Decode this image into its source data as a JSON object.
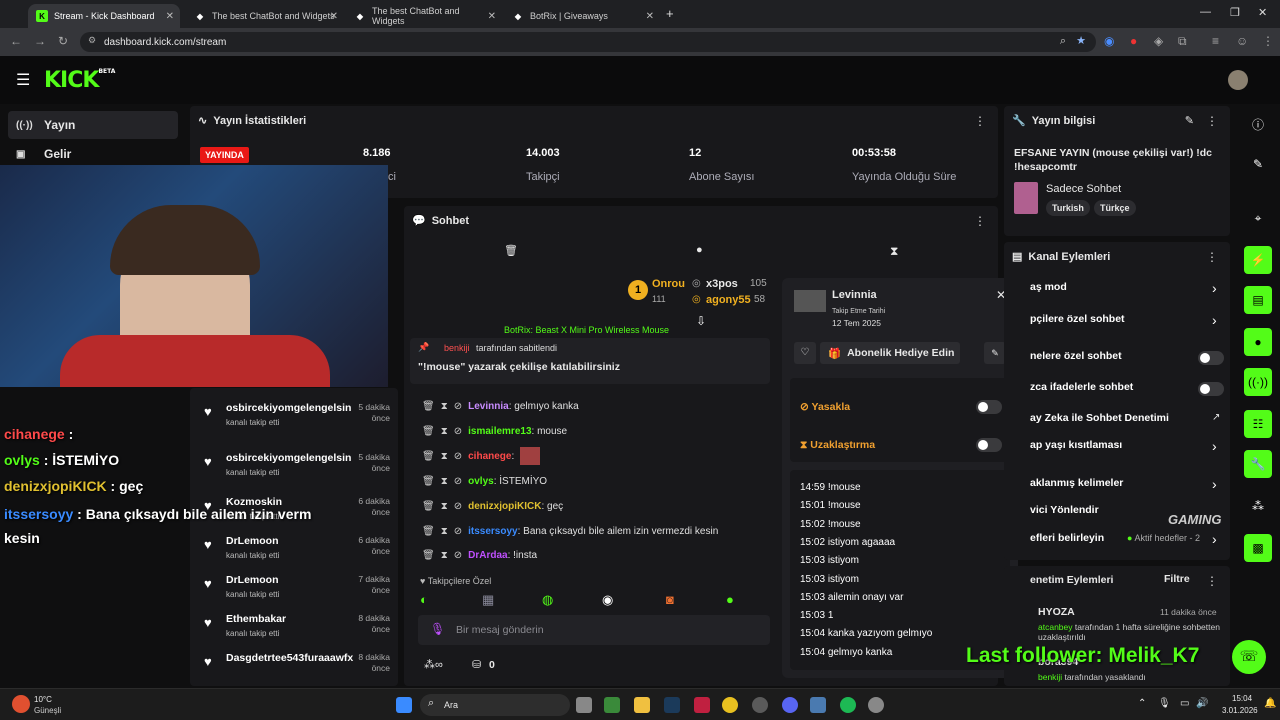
{
  "browser": {
    "tabs": [
      {
        "title": "Stream - Kick Dashboard",
        "active": true
      },
      {
        "title": "The best ChatBot and Widgets",
        "active": false
      },
      {
        "title": "The best ChatBot and Widgets",
        "active": false
      },
      {
        "title": "BotRix | Giveaways",
        "active": false
      }
    ],
    "url": "dashboard.kick.com/stream"
  },
  "header": {
    "logo": "KICK",
    "logo_sup": "BETA"
  },
  "sidebar": {
    "items": [
      {
        "label": "Yayın",
        "icon": "broadcast-icon"
      },
      {
        "label": "Gelir",
        "icon": "revenue-icon"
      }
    ]
  },
  "stats": {
    "title": "Yayın İstatistikleri",
    "live_badge": "YAYINDA",
    "viewers_value": "8.186",
    "viewers_label_fragment": "ci",
    "followers_value": "14.003",
    "followers_label": "Takipçi",
    "subs_value": "12",
    "subs_label": "Abone Sayısı",
    "duration_value": "00:53:58",
    "duration_label": "Yayında Olduğu Süre"
  },
  "stream_info": {
    "title": "Yayın bilgisi",
    "stream_title": "EFSANE YAYIN (mouse çekilişi var!) !dc !hesapcomtr",
    "category": "Sadece Sohbet",
    "tags": [
      "Turkish",
      "Türkçe"
    ]
  },
  "chat": {
    "title": "Sohbet",
    "leaderboard": [
      {
        "rank": "1",
        "name": "Onrou",
        "value": "111"
      },
      {
        "name": "x3pos",
        "value": "105"
      },
      {
        "name": "agony55",
        "value": "58"
      }
    ],
    "truncated_top": "BotRix: Beast X Mini Pro Wireless Mouse",
    "pinned_by": "benkiji",
    "pinned_by_suffix": "tarafından sabitlendi",
    "pinned_message": "\"!mouse\" yazarak çekilişe katılabilirsiniz",
    "messages": [
      {
        "user": "Levinnia",
        "color": "#c88cff",
        "text": "gelmıyo kanka"
      },
      {
        "user": "ismailemre13",
        "color": "#53fc18",
        "text": "mouse"
      },
      {
        "user": "cihanege",
        "color": "#ff4a4a",
        "text": ""
      },
      {
        "user": "ovlys",
        "color": "#53fc18",
        "text": "İSTEMİYO"
      },
      {
        "user": "denizxjopiKICK",
        "color": "#e0c030",
        "text": "geç"
      },
      {
        "user": "itssersoyy",
        "color": "#3a8bff",
        "text": "Bana çıksaydı bile ailem izin vermezdi kesin"
      },
      {
        "user": "DrArdaa",
        "color": "#c050ff",
        "text": "!insta"
      }
    ],
    "follower_only_label": "Takipçilere Özel",
    "input_placeholder": "Bir mesaj gönderin",
    "points": "0"
  },
  "followers": [
    {
      "name": "osbircekiyomgelengelsin",
      "sub": "kanalı takip etti",
      "time": "5 dakika önce"
    },
    {
      "name": "osbircekiyomgelengelsin",
      "sub": "kanalı takip etti",
      "time": "5 dakika önce"
    },
    {
      "name": "Kozmoskin",
      "sub": "kanalı takip etti",
      "time": "6 dakika önce"
    },
    {
      "name": "DrLemoon",
      "sub": "kanalı takip etti",
      "time": "6 dakika önce"
    },
    {
      "name": "DrLemoon",
      "sub": "kanalı takip etti",
      "time": "7 dakika önce"
    },
    {
      "name": "Ethembakar",
      "sub": "kanalı takip etti",
      "time": "8 dakika önce"
    },
    {
      "name": "Dasgdetrtee543furaaawfx",
      "sub": "",
      "time": "8 dakika önce"
    }
  ],
  "overlay_chat": [
    {
      "user": "cihanege",
      "sep": " : ",
      "text": "",
      "color": "#ff4a4a"
    },
    {
      "user": "ovlys",
      "sep": " : ",
      "text": "İSTEMİYO",
      "color": "#53fc18"
    },
    {
      "user": "denizxjopiKICK",
      "sep": " : ",
      "text": "geç",
      "color": "#e0c030"
    },
    {
      "user": "itssersoyy",
      "sep": " : ",
      "text": "Bana çıksaydı bile ailem izin verm",
      "color": "#3a8bff"
    },
    {
      "user": "",
      "sep": "",
      "text": "kesin",
      "color": "#ffffff"
    }
  ],
  "user_card": {
    "name": "Levinnia",
    "follow_label": "Takip Etme Tarihi",
    "follow_date": "12 Tem 2025",
    "gift_label": "Abonelik Hediye Edin",
    "ban_label": "Yasakla",
    "timeout_label": "Uzaklaştırma",
    "history": [
      {
        "time": "14:59",
        "text": "!mouse"
      },
      {
        "time": "15:01",
        "text": "!mouse"
      },
      {
        "time": "15:02",
        "text": "!mouse"
      },
      {
        "time": "15:02",
        "text": "istiyom agaaaa"
      },
      {
        "time": "15:03",
        "text": "istiyom"
      },
      {
        "time": "15:03",
        "text": "istiyom"
      },
      {
        "time": "15:03",
        "text": "ailemin onayı var"
      },
      {
        "time": "15:03",
        "text": "1"
      },
      {
        "time": "15:04",
        "text": "kanka yazıyom gelmıyo"
      },
      {
        "time": "15:04",
        "text": "gelmıyo kanka"
      }
    ]
  },
  "channel_actions": {
    "title": "Kanal Eylemleri",
    "rows": [
      {
        "label": "aş mod",
        "control": "chevron"
      },
      {
        "label": "pçilere özel sohbet",
        "control": "chevron"
      },
      {
        "label": "nelere özel sohbet",
        "control": "toggle"
      },
      {
        "label": "zca ifadelerle sohbet",
        "control": "toggle"
      },
      {
        "label": "ay Zeka ile Sohbet Denetimi",
        "control": "external"
      },
      {
        "label": "ap yaşı kısıtlaması",
        "control": "chevron"
      },
      {
        "label": "aklanmış kelimeler",
        "control": "chevron"
      },
      {
        "label": "vici Yönlendir",
        "control": "none"
      },
      {
        "label": "efleri belirleyin",
        "control": "chevron"
      }
    ],
    "active_goals": "Aktif hedefler - 2"
  },
  "mod_actions": {
    "title": "enetim Eylemleri",
    "filter": "Filtre",
    "entries": [
      {
        "user": "HYOZA",
        "time": "11 dakika önce",
        "actor": "atcanbey",
        "text": "tarafından 1 hafta süreliğine sohbetten uzaklaştırıldı"
      },
      {
        "user": "bora394",
        "time": "",
        "actor": "benkiji",
        "text": "tarafından yasaklandı"
      }
    ]
  },
  "overlay": {
    "last_follower": "Last follower: Melik_K7",
    "gaming_logo": "GAMING"
  },
  "taskbar": {
    "temp": "10°C",
    "weather": "Güneşli",
    "search": "Ara",
    "time": "15:04",
    "date": "3.01.2026"
  }
}
